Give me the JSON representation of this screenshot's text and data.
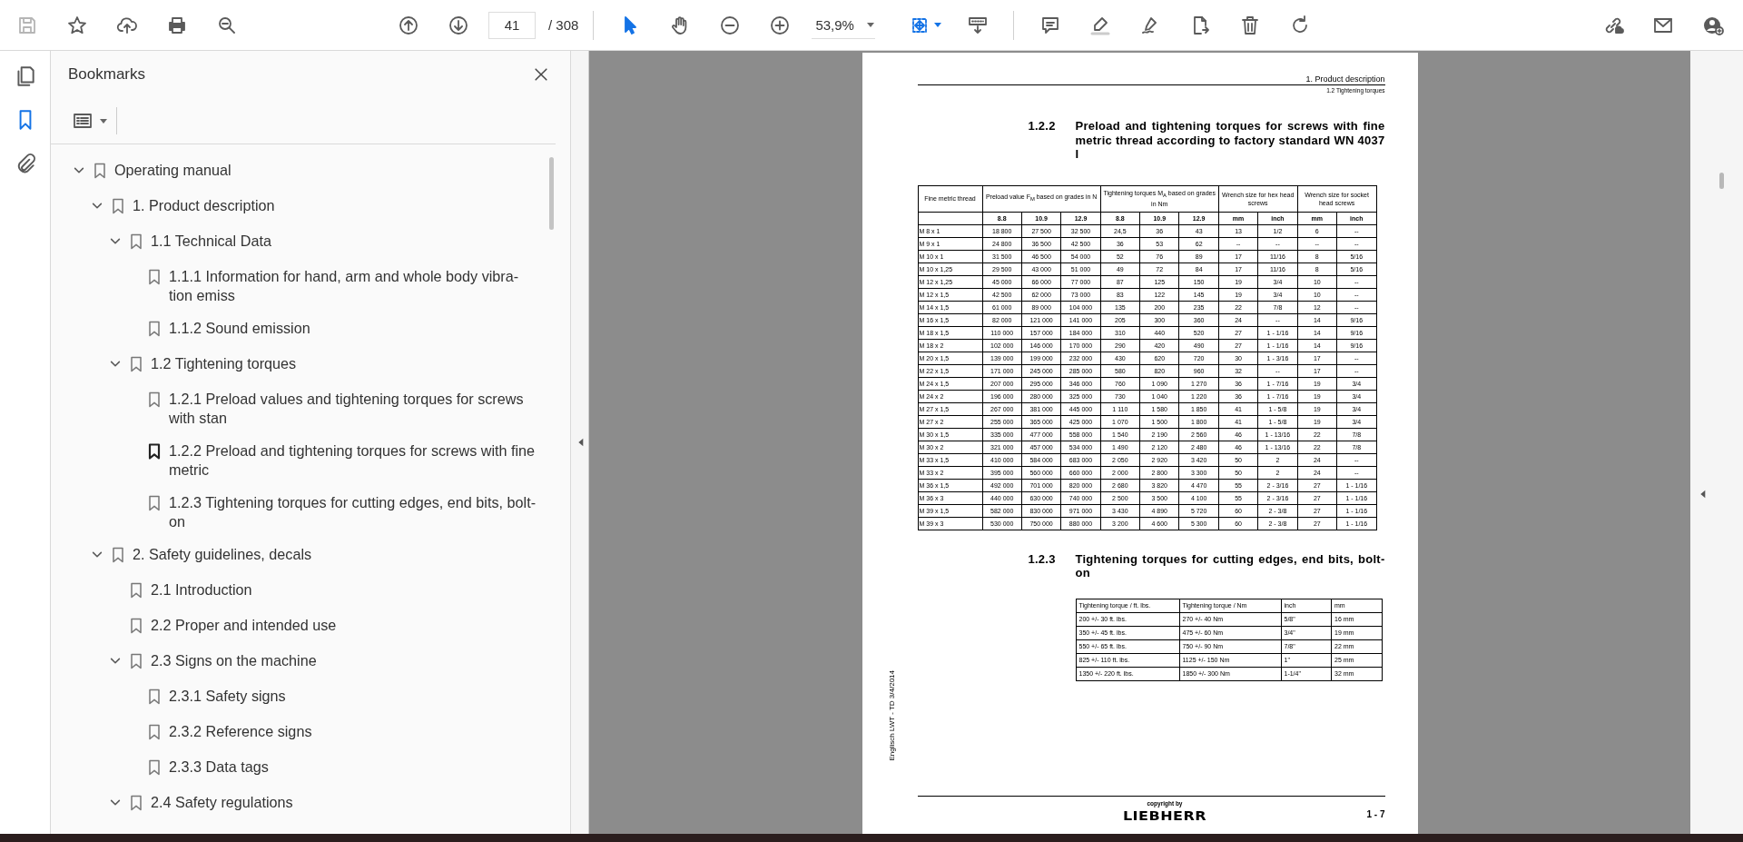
{
  "toolbar": {
    "page_number": "41",
    "page_total": "/ 308",
    "zoom": "53,9%",
    "tools": [
      {
        "kind": "select",
        "selected": true
      },
      {
        "kind": "hand",
        "selected": false
      }
    ]
  },
  "side_rail": [
    {
      "kind": "pages",
      "selected": false
    },
    {
      "kind": "bookmarks",
      "selected": true
    },
    {
      "kind": "attachments",
      "selected": false
    }
  ],
  "bookmarks_panel": {
    "title": "Bookmarks"
  },
  "bookmarks": [
    {
      "label": "Operating manual",
      "expanded": true,
      "selected": false,
      "children": [
        {
          "label": "1. Product description",
          "expanded": true,
          "selected": false,
          "children": [
            {
              "label": "1.1 Technical Data",
              "expanded": true,
              "selected": false,
              "children": [
                {
                  "label": "1.1.1 Information for hand, arm and whole body vibra- tion emiss",
                  "selected": false
                },
                {
                  "label": "1.1.2 Sound emission",
                  "selected": false
                }
              ]
            },
            {
              "label": "1.2 Tightening torques",
              "expanded": true,
              "selected": false,
              "children": [
                {
                  "label": "1.2.1 Preload values and tightening torques for screws with stan",
                  "selected": false
                },
                {
                  "label": "1.2.2 Preload and tightening torques for screws with fine metric",
                  "selected": true
                },
                {
                  "label": "1.2.3 Tightening torques for cutting edges, end bits, bolt-on",
                  "selected": false
                }
              ]
            }
          ]
        },
        {
          "label": "2. Safety guidelines, decals",
          "expanded": true,
          "selected": false,
          "children": [
            {
              "label": "2.1 Introduction",
              "selected": false
            },
            {
              "label": "2.2 Proper and intended use",
              "selected": false
            },
            {
              "label": "2.3 Signs on the machine",
              "expanded": true,
              "selected": false,
              "children": [
                {
                  "label": "2.3.1 Safety signs",
                  "selected": false
                },
                {
                  "label": "2.3.2 Reference signs",
                  "selected": false
                },
                {
                  "label": "2.3.3 Data tags",
                  "selected": false
                }
              ]
            },
            {
              "label": "2.4 Safety regulations",
              "expanded": true,
              "selected": false
            }
          ]
        }
      ]
    }
  ],
  "page": {
    "header": "1. Product description",
    "subheader": "1.2 Tightening torques",
    "section_1": {
      "number": "1.2.2",
      "title": "Preload and tightening torques for screws with fine metric thread according to factory standard WN 4037 I"
    },
    "table_1": {
      "column_groups": [
        {
          "title": "Fine metric thread"
        },
        {
          "title": "Preload value F$_{M}$ based on grades in N",
          "columns": [
            "8.8",
            "10.9",
            "12.9"
          ]
        },
        {
          "title": "Tightening torques M$_{A}$ based on grades in Nm",
          "columns": [
            "8.8",
            "10.9",
            "12.9"
          ]
        },
        {
          "title": "Wrench size for hex head screws",
          "columns": [
            "mm",
            "inch"
          ]
        },
        {
          "title": "Wrench size for socket head screws",
          "columns": [
            "mm",
            "inch"
          ]
        }
      ],
      "rows": [
        [
          "M 8 x 1",
          "18 800",
          "27 500",
          "32 500",
          "24,5",
          "36",
          "43",
          "13",
          "1/2",
          "6",
          "--"
        ],
        [
          "M 9 x 1",
          "24 800",
          "36 500",
          "42 500",
          "36",
          "53",
          "62",
          "--",
          "--",
          "--",
          "--"
        ],
        [
          "M 10 x 1",
          "31 500",
          "46 500",
          "54 000",
          "52",
          "76",
          "89",
          "17",
          "11/16",
          "8",
          "5/16"
        ],
        [
          "M 10 x 1,25",
          "29 500",
          "43 000",
          "51 000",
          "49",
          "72",
          "84",
          "17",
          "11/16",
          "8",
          "5/16"
        ],
        [
          "M 12 x 1,25",
          "45 000",
          "66 000",
          "77 000",
          "87",
          "125",
          "150",
          "19",
          "3/4",
          "10",
          "--"
        ],
        [
          "M 12 x 1,5",
          "42 500",
          "62 000",
          "73 000",
          "83",
          "122",
          "145",
          "19",
          "3/4",
          "10",
          "--"
        ],
        [
          "M 14 x 1,5",
          "61 000",
          "89 000",
          "104 000",
          "135",
          "200",
          "235",
          "22",
          "7/8",
          "12",
          "--"
        ],
        [
          "M 16 x 1,5",
          "82 000",
          "121 000",
          "141 000",
          "205",
          "300",
          "360",
          "24",
          "--",
          "14",
          "9/16"
        ],
        [
          "M 18 x 1,5",
          "110 000",
          "157 000",
          "184 000",
          "310",
          "440",
          "520",
          "27",
          "1 - 1/16",
          "14",
          "9/16"
        ],
        [
          "M 18 x 2",
          "102 000",
          "146 000",
          "170 000",
          "290",
          "420",
          "490",
          "27",
          "1 - 1/16",
          "14",
          "9/16"
        ],
        [
          "M 20 x 1,5",
          "139 000",
          "199 000",
          "232 000",
          "430",
          "620",
          "720",
          "30",
          "1 - 3/16",
          "17",
          "--"
        ],
        [
          "M 22 x 1,5",
          "171 000",
          "245 000",
          "285 000",
          "580",
          "820",
          "960",
          "32",
          "--",
          "17",
          "--"
        ],
        [
          "M 24 x 1,5",
          "207 000",
          "295 000",
          "346 000",
          "760",
          "1 090",
          "1 270",
          "36",
          "1 - 7/16",
          "19",
          "3/4"
        ],
        [
          "M 24 x 2",
          "196 000",
          "280 000",
          "325 000",
          "730",
          "1 040",
          "1 220",
          "36",
          "1 - 7/16",
          "19",
          "3/4"
        ],
        [
          "M 27 x 1,5",
          "267 000",
          "381 000",
          "445 000",
          "1 110",
          "1 580",
          "1 850",
          "41",
          "1 - 5/8",
          "19",
          "3/4"
        ],
        [
          "M 27 x 2",
          "255 000",
          "365 000",
          "425 000",
          "1 070",
          "1 500",
          "1 800",
          "41",
          "1 - 5/8",
          "19",
          "3/4"
        ],
        [
          "M 30 x 1,5",
          "335 000",
          "477 000",
          "558 000",
          "1 540",
          "2 190",
          "2 560",
          "46",
          "1 - 13/16",
          "22",
          "7/8"
        ],
        [
          "M 30 x 2",
          "321 000",
          "457 000",
          "534 000",
          "1 490",
          "2 120",
          "2 480",
          "46",
          "1 - 13/16",
          "22",
          "7/8"
        ],
        [
          "M 33 x 1,5",
          "410 000",
          "584 000",
          "683 000",
          "2 050",
          "2 920",
          "3 420",
          "50",
          "2",
          "24",
          "--"
        ],
        [
          "M 33 x 2",
          "395 000",
          "560 000",
          "660 000",
          "2 000",
          "2 800",
          "3 300",
          "50",
          "2",
          "24",
          "--"
        ],
        [
          "M 36 x 1,5",
          "492 000",
          "701 000",
          "820 000",
          "2 680",
          "3 820",
          "4 470",
          "55",
          "2 - 3/16",
          "27",
          "1 - 1/16"
        ],
        [
          "M 36 x 3",
          "440 000",
          "630 000",
          "740 000",
          "2 500",
          "3 500",
          "4 100",
          "55",
          "2 - 3/16",
          "27",
          "1 - 1/16"
        ],
        [
          "M 39 x 1,5",
          "582 000",
          "830 000",
          "971 000",
          "3 430",
          "4 890",
          "5 720",
          "60",
          "2 - 3/8",
          "27",
          "1 - 1/16"
        ],
        [
          "M 39 x 3",
          "530 000",
          "750 000",
          "880 000",
          "3 200",
          "4 600",
          "5 300",
          "60",
          "2 - 3/8",
          "27",
          "1 - 1/16"
        ]
      ]
    },
    "section_2": {
      "number": "1.2.3",
      "title": "Tightening torques for cutting edges, end bits, bolt-on"
    },
    "table_2": {
      "columns": [
        "Tightening torque / ft. lbs.",
        "Tightening torque / Nm",
        "inch",
        "mm"
      ],
      "rows": [
        [
          "200 +/- 30 ft. lbs.",
          "270 +/- 40 Nm",
          "5/8\"",
          "16 mm"
        ],
        [
          "350 +/- 45 ft. lbs.",
          "475 +/- 60 Nm",
          "3/4\"",
          "19 mm"
        ],
        [
          "550 +/- 65 ft. lbs.",
          "750 +/- 90 Nm",
          "7/8\"",
          "22 mm"
        ],
        [
          "825 +/- 110 ft. lbs.",
          "1125 +/- 150 Nm",
          "1\"",
          "25 mm"
        ],
        [
          "1350 +/- 220 ft. lbs.",
          "1850 +/- 300 Nm",
          "1-1/4\"",
          "32 mm"
        ]
      ]
    },
    "margin_note": "Englisch LWT - TD 3/4/2014",
    "copyright": "copyright by",
    "logo": "LIEBHERR",
    "page_label": "1 - 7"
  }
}
